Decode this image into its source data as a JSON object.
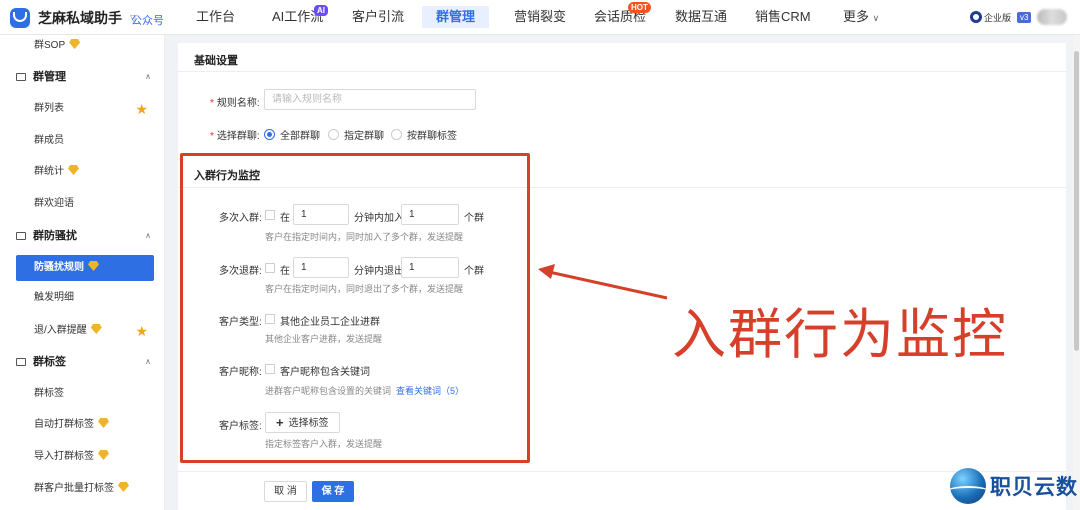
{
  "brand": {
    "name": "芝麻私域助手",
    "public_label": "公众号"
  },
  "nav": {
    "items": [
      {
        "label": "工作台"
      },
      {
        "label": "AI工作流",
        "badge": "AI"
      },
      {
        "label": "客户引流"
      },
      {
        "label": "群管理",
        "active": true
      },
      {
        "label": "营销裂变"
      },
      {
        "label": "会话质检",
        "badge": "HOT"
      },
      {
        "label": "数据互通"
      },
      {
        "label": "销售CRM"
      },
      {
        "label": "更多"
      }
    ],
    "edition": "企业版",
    "version": "v3"
  },
  "sidebar": {
    "items": [
      {
        "label": "群SOP",
        "type": "item",
        "premium": true
      },
      {
        "label": "群管理",
        "type": "group"
      },
      {
        "label": "群列表",
        "type": "item",
        "starred": true
      },
      {
        "label": "群成员",
        "type": "item"
      },
      {
        "label": "群统计",
        "type": "item",
        "premium": true
      },
      {
        "label": "群欢迎语",
        "type": "item"
      },
      {
        "label": "群防骚扰",
        "type": "group"
      },
      {
        "label": "防骚扰规则",
        "type": "item",
        "active": true,
        "premium": true
      },
      {
        "label": "触发明细",
        "type": "item"
      },
      {
        "label": "退/入群提醒",
        "type": "item",
        "premium": true,
        "starred": true
      },
      {
        "label": "群标签",
        "type": "group"
      },
      {
        "label": "群标签",
        "type": "item"
      },
      {
        "label": "自动打群标签",
        "type": "item",
        "premium": true
      },
      {
        "label": "导入打群标签",
        "type": "item",
        "premium": true
      },
      {
        "label": "群客户批量打标签",
        "type": "item",
        "premium": true
      }
    ]
  },
  "form": {
    "basic_title": "基础设置",
    "rule_name_label": "规则名称:",
    "rule_name_placeholder": "请输入规则名称",
    "select_group_label": "选择群聊:",
    "group_options": [
      "全部群聊",
      "指定群聊",
      "按群聊标签"
    ],
    "monitor_title": "入群行为监控",
    "multi_join": {
      "label": "多次入群:",
      "in": "在",
      "minutes": "1",
      "mid": "分钟内加入",
      "count": "1",
      "unit": "个群",
      "hint": "客户在指定时间内，同时加入了多个群，发送提醒"
    },
    "multi_leave": {
      "label": "多次退群:",
      "in": "在",
      "minutes": "1",
      "mid": "分钟内退出",
      "count": "1",
      "unit": "个群",
      "hint": "客户在指定时间内，同时退出了多个群，发送提醒"
    },
    "customer_type": {
      "label": "客户类型:",
      "option": "其他企业员工企业进群",
      "hint": "其他企业客户进群，发送提醒"
    },
    "customer_nickname": {
      "label": "客户昵称:",
      "option": "客户昵称包含关键词",
      "hint": "进群客户昵称包含设置的关键词",
      "link": "查看关键词（5）"
    },
    "customer_tag": {
      "label": "客户标签:",
      "button": "选择标签",
      "hint": "指定标签客户入群，发送提醒"
    },
    "cancel": "取 消",
    "save": "保 存"
  },
  "annotation": {
    "text": "入群行为监控"
  },
  "watermark": {
    "text": "职贝云数"
  },
  "colors": {
    "accent": "#2f6fe4",
    "annotation": "#d6402a"
  }
}
